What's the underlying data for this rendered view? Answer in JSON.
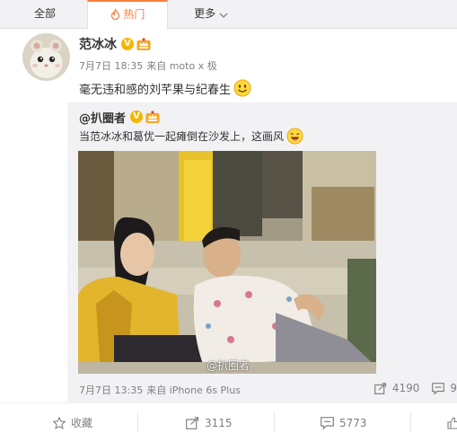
{
  "tabs": [
    {
      "label": "全部"
    },
    {
      "label": "热门"
    },
    {
      "label": "更多"
    }
  ],
  "post": {
    "author": "范冰冰",
    "verified_badge": "V",
    "time": "7月7日 18:35",
    "source": "来自 moto x 极",
    "text": "毫无违和感的刘芊果与纪春生",
    "emoji": "smile-emoji"
  },
  "repost": {
    "author": "@扒圈者",
    "verified_badge": "V",
    "text": "当范冰冰和葛优一起瘫倒在沙发上，这画风",
    "emoji": "laugh-emoji",
    "image_watermark": "@扒圈者",
    "time": "7月7日 13:35",
    "source": "来自 iPhone 6s Plus",
    "share_count": "4190",
    "comment_count": "9"
  },
  "actions": {
    "favorite": "收藏",
    "share": "3115",
    "comment": "5773"
  },
  "colors": {
    "accent": "#fa7d3c",
    "badge": "#f7b500",
    "meta_text": "#808080",
    "repost_bg": "#f2f2f5"
  }
}
